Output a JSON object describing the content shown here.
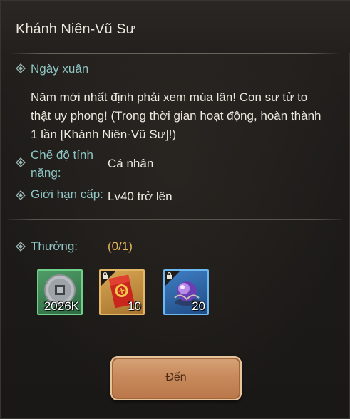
{
  "window": {
    "title": "Khánh Niên-Vũ Sư"
  },
  "event": {
    "name": "Ngày xuân",
    "description": "Năm mới nhất định phải xem múa lân! Con sư tử to thật uy phong! (Trong thời gian hoạt động, hoàn thành 1 lần [Khánh Niên-Vũ Sư]!)"
  },
  "mode": {
    "label": "Chế độ tính năng:",
    "value": "Cá nhân"
  },
  "level": {
    "label": "Giới hạn cấp:",
    "value": "Lv40 trở lên"
  },
  "rewards": {
    "label": "Thưởng:",
    "progress": "(0/1)",
    "items": [
      {
        "icon": "silver-coin-icon",
        "quantity": "2026K",
        "locked": false,
        "border_color": "#6fd08a"
      },
      {
        "icon": "red-envelope-icon",
        "quantity": "10",
        "locked": true,
        "border_color": "#e2b866"
      },
      {
        "icon": "purple-orb-icon",
        "quantity": "20",
        "locked": true,
        "border_color": "#6cb8f0"
      }
    ]
  },
  "actions": {
    "go_label": "Đến"
  },
  "colors": {
    "accent_teal": "#8fc7c4",
    "progress_gold": "#e8b55a",
    "button_bronze": "#c88a5c"
  }
}
